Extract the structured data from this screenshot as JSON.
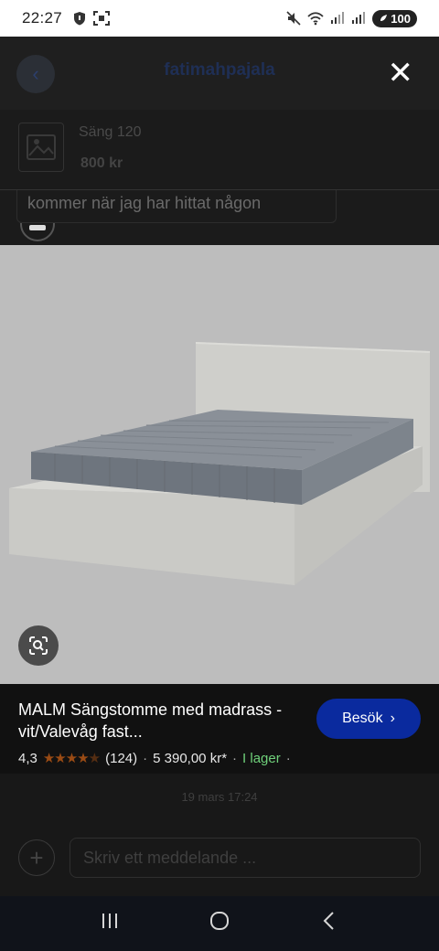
{
  "status_bar": {
    "time": "22:27",
    "battery": "100"
  },
  "chat": {
    "title": "fatimahpajala",
    "listing_title": "Säng 120",
    "listing_price": "800 kr",
    "message": "kommer när jag har hittat någon",
    "timestamp": "19 mars 17:24",
    "compose_placeholder": "Skriv ett meddelande ..."
  },
  "product": {
    "name": "MALM Sängstomme med madrass - vit/Valevåg fast...",
    "visit_label": "Besök",
    "rating": "4,3",
    "rating_value": 4.3,
    "reviews": "(124)",
    "price": "5 390,00 kr*",
    "stock": "I lager"
  },
  "colors": {
    "visit_button": "#0a2a9e",
    "stock_green": "#6fd07a",
    "stars": "#9a4b14"
  },
  "icons": [
    "back-arrow-icon",
    "close-icon",
    "image-placeholder-icon",
    "lens-search-icon",
    "plus-icon",
    "nav-recents-icon",
    "nav-home-icon",
    "nav-back-icon"
  ]
}
